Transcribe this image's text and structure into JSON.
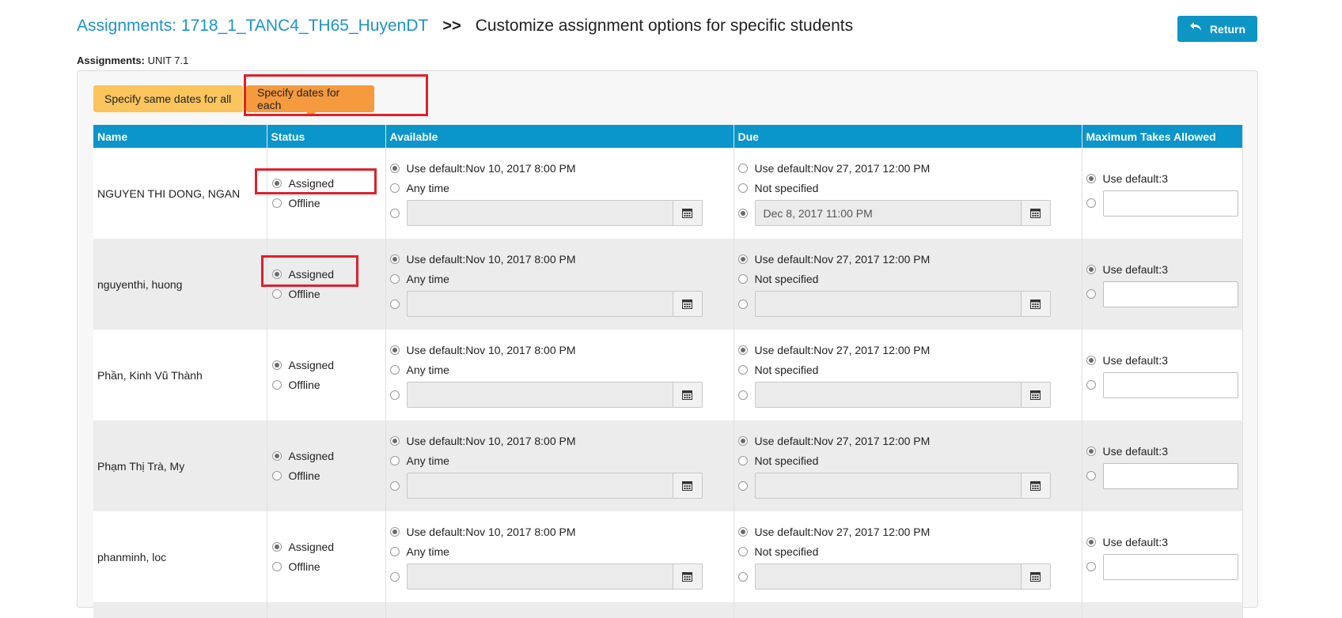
{
  "header": {
    "assignments_link": "Assignments: 1718_1_TANC4_TH65_HuyenDT",
    "separator": ">>",
    "title": "Customize assignment options for specific students",
    "return_label": "Return"
  },
  "assignment_line": {
    "label": "Assignments:",
    "value": "UNIT 7.1"
  },
  "tabs": {
    "same_dates": "Specify same dates for all",
    "each_dates": "Specify dates for each",
    "active": "each_dates"
  },
  "columns": {
    "name": "Name",
    "status": "Status",
    "available": "Available",
    "due": "Due",
    "max": "Maximum Takes Allowed"
  },
  "labels": {
    "assigned": "Assigned",
    "offline": "Offline",
    "available_default": "Use default:Nov 10, 2017 8:00 PM",
    "any_time": "Any time",
    "due_default": "Use default:Nov 27, 2017 12:00 PM",
    "not_specified": "Not specified",
    "max_default": "Use default:3"
  },
  "students": [
    {
      "name": "NGUYEN THI DONG, NGAN",
      "status": "assigned",
      "available": "default",
      "due": "custom",
      "due_value": "Dec 8, 2017 11:00 PM",
      "max": "default"
    },
    {
      "name": "nguyenthi, huong",
      "status": "assigned",
      "available": "default",
      "due": "default",
      "due_value": "",
      "max": "default"
    },
    {
      "name": "Phần, Kinh Vũ Thành",
      "status": "assigned",
      "available": "default",
      "due": "default",
      "due_value": "",
      "max": "default"
    },
    {
      "name": "Phạm Thị Trà, My",
      "status": "assigned",
      "available": "default",
      "due": "default",
      "due_value": "",
      "max": "default"
    },
    {
      "name": "phanminh, loc",
      "status": "assigned",
      "available": "default",
      "due": "default",
      "due_value": "",
      "max": "default"
    }
  ],
  "colors": {
    "header_blue": "#0a95cb",
    "link_blue": "#1d93c9",
    "tab_yellow": "#f9c55c",
    "tab_orange": "#f59a3d",
    "highlight_red": "#e0202a"
  },
  "icons": {
    "return": "return-arrow-icon",
    "calendar": "calendar-icon"
  }
}
